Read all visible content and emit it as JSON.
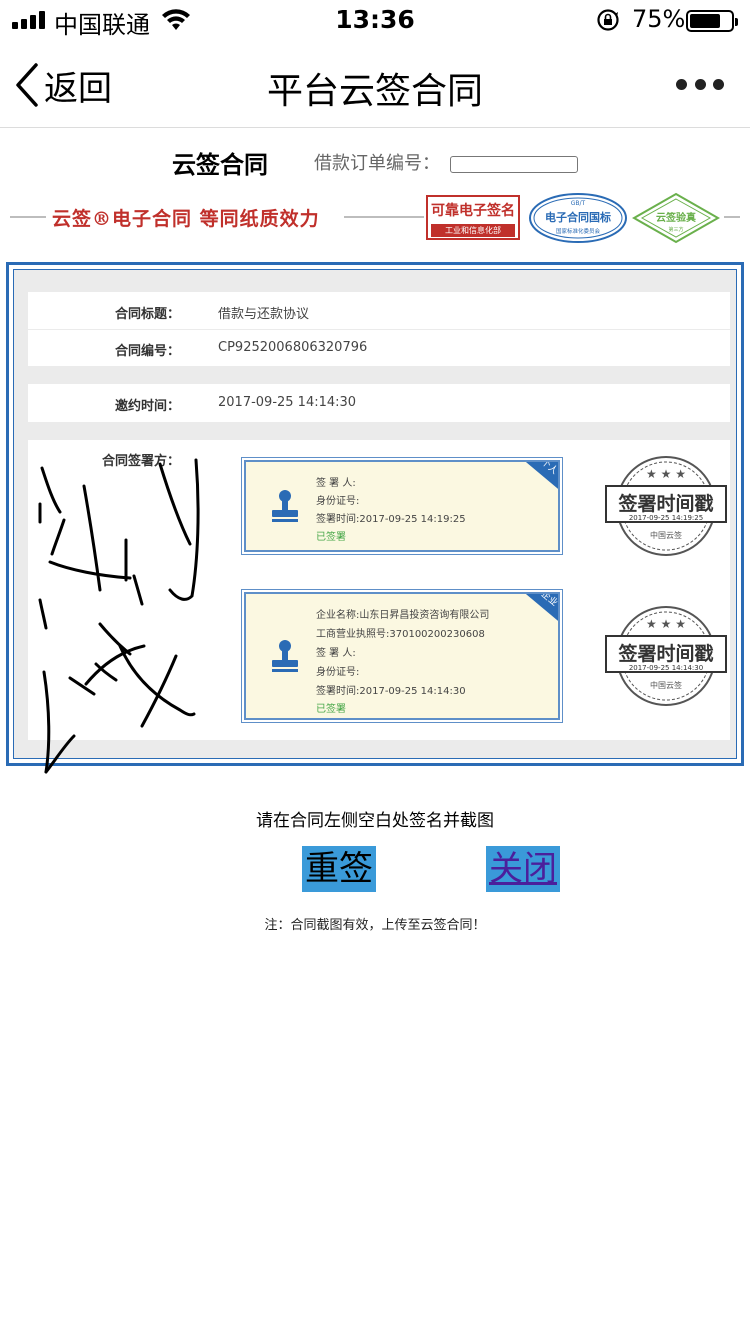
{
  "status_bar": {
    "carrier": "中国联通",
    "time": "13:36",
    "battery_percent": "75%",
    "battery_level": 0.75
  },
  "nav": {
    "back_label": "返回",
    "title": "平台云签合同"
  },
  "contract_header": {
    "name": "云签合同",
    "order_label": "借款订单编号：",
    "order_value": ""
  },
  "banner": {
    "slogan": "云签®电子合同  等同纸质效力",
    "badge_reliable": "可靠电子签名",
    "badge_reliable_sub": "工业和信息化部",
    "badge_national_top": "GB/T",
    "badge_national": "电子合同国标",
    "badge_national_sub": "国家标准化委员会",
    "badge_verify": "云签验真",
    "badge_verify_sub": "第三方"
  },
  "document": {
    "title_label": "合同标题：",
    "title_value": "借款与还款协议",
    "number_label": "合同编号：",
    "number_value": "CP9252006806320796",
    "invite_label": "邀约时间：",
    "invite_value": "2017-09-25 14:14:30",
    "parties_label": "合同签署方：",
    "signers": [
      {
        "corner": "个人",
        "lines": [
          "签 署 人:",
          "身份证号:",
          "签署时间:2017-09-25 14:19:25"
        ],
        "status": "已签署",
        "timestamp": "2017-09-25 14:19:25"
      },
      {
        "corner": "企业",
        "lines": [
          "企业名称:山东日昇昌投资咨询有限公司",
          "工商营业执照号:370100200230608",
          "签 署 人:",
          "身份证号:",
          "签署时间:2017-09-25 14:14:30"
        ],
        "status": "已签署",
        "timestamp": "2017-09-25 14:14:30"
      }
    ],
    "ts_stamp_title": "签署时间戳",
    "ts_stamp_sub": "中国云签"
  },
  "actions": {
    "instruction": "请在合同左侧空白处签名并截图",
    "resign": "重签",
    "close": "关闭",
    "note": "注：合同截图有效，上传至云签合同！"
  },
  "colors": {
    "frame_blue": "#2a6bb5",
    "slogan_red": "#c0302b",
    "button_blue": "#3a9ad9",
    "signed_green": "#4aa84a"
  }
}
